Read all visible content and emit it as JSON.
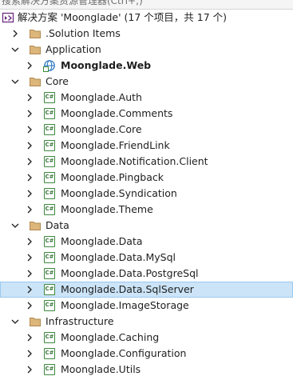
{
  "search": {
    "placeholder": "搜索解决方案资源管理器(Ctrl+;)"
  },
  "solution": {
    "label": "解决方案 'Moonglade' (17 个项目，共 17 个)"
  },
  "tree": {
    "solution_items": ".Solution Items",
    "application": {
      "label": "Application",
      "web": "Moonglade.Web"
    },
    "core": {
      "label": "Core",
      "items": [
        "Moonglade.Auth",
        "Moonglade.Comments",
        "Moonglade.Core",
        "Moonglade.FriendLink",
        "Moonglade.Notification.Client",
        "Moonglade.Pingback",
        "Moonglade.Syndication",
        "Moonglade.Theme"
      ]
    },
    "data": {
      "label": "Data",
      "items": [
        "Moonglade.Data",
        "Moonglade.Data.MySql",
        "Moonglade.Data.PostgreSql",
        "Moonglade.Data.SqlServer",
        "Moonglade.ImageStorage"
      ]
    },
    "infrastructure": {
      "label": "Infrastructure",
      "items": [
        "Moonglade.Caching",
        "Moonglade.Configuration",
        "Moonglade.Utils"
      ]
    }
  },
  "icons": {
    "solution": "solution-icon",
    "folder": "folder-icon",
    "web_project": "globe-project-icon",
    "csharp_project": "csharp-project-icon",
    "csharp_text": "C#"
  },
  "colors": {
    "selected_background": "#cce4f7",
    "folder": "#dcb67a",
    "csharp_green": "#3c8a3c",
    "solution_purple": "#68217a"
  }
}
